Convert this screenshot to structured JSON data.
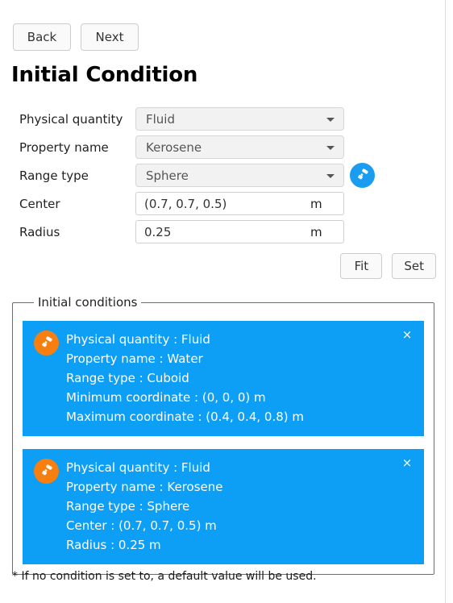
{
  "nav": {
    "back_label": "Back",
    "next_label": "Next"
  },
  "page_title": "Initial Condition",
  "form": {
    "rows": [
      {
        "label": "Physical quantity",
        "type": "select",
        "value": "Fluid",
        "unit": ""
      },
      {
        "label": "Property name",
        "type": "select",
        "value": "Kerosene",
        "unit": ""
      },
      {
        "label": "Range type",
        "type": "select",
        "value": "Sphere",
        "unit": ""
      },
      {
        "label": "Center",
        "type": "input",
        "value": "(0.7, 0.7, 0.5)",
        "unit": "m"
      },
      {
        "label": "Radius",
        "type": "input",
        "value": "0.25",
        "unit": "m"
      }
    ],
    "paint_icon": "paint-roller-icon"
  },
  "actions": {
    "fit_label": "Fit",
    "set_label": "Set"
  },
  "conditions": {
    "legend": "Initial conditions",
    "close_glyph": "×",
    "cards": [
      {
        "icon": "paint-roller-icon",
        "lines": [
          "Physical quantity : Fluid",
          "Property name : Water",
          "Range type : Cuboid",
          "Minimum coordinate : (0, 0, 0) m",
          "Maximum coordinate : (0.4, 0.4, 0.8) m"
        ]
      },
      {
        "icon": "paint-roller-icon",
        "lines": [
          "Physical quantity : Fluid",
          "Property name : Kerosene",
          "Range type : Sphere",
          "Center : (0.7, 0.7, 0.5) m",
          "Radius : 0.25 m"
        ]
      }
    ]
  },
  "note": "* If no condition is set to, a default value will be used.",
  "colors": {
    "card_blue": "#0d9ef5",
    "card_icon_orange": "#f77f10",
    "paint_button_blue": "#1a9cf0",
    "fieldset_border": "#6b6b6b"
  }
}
